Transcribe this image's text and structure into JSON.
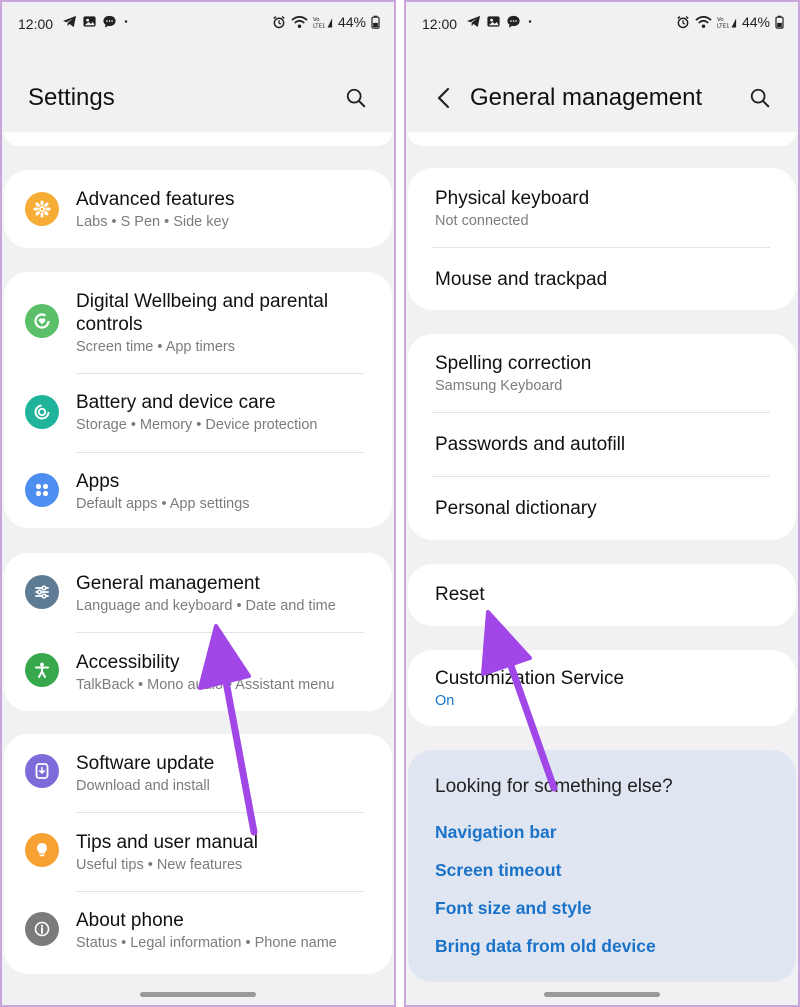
{
  "status_bar": {
    "time": "12:00",
    "battery": "44%",
    "network": "Vo)) LTE1"
  },
  "left_screen": {
    "title": "Settings",
    "items": [
      {
        "title": "Advanced features",
        "subtitle": "Labs  •  S Pen  •  Side key",
        "icon": "advanced-features-icon",
        "color": "#f6ac35"
      },
      {
        "title": "Digital Wellbeing and parental",
        "title_line2": "controls",
        "subtitle": "Screen time  •  App timers",
        "icon": "digital-wellbeing-icon",
        "color": "#5cc06a"
      },
      {
        "title": "Battery and device care",
        "subtitle": "Storage  •  Memory  •  Device protection",
        "icon": "device-care-icon",
        "color": "#1fb39c"
      },
      {
        "title": "Apps",
        "subtitle": "Default apps  •  App settings",
        "icon": "apps-icon",
        "color": "#4d8ff0"
      },
      {
        "title": "General management",
        "subtitle": "Language and keyboard  •  Date and time",
        "icon": "sliders-icon",
        "color": "#5e7b95"
      },
      {
        "title": "Accessibility",
        "subtitle": "TalkBack  •  Mono audio  •  Assistant menu",
        "icon": "accessibility-icon",
        "color": "#38a84d"
      },
      {
        "title": "Software update",
        "subtitle": "Download and install",
        "icon": "software-update-icon",
        "color": "#7c6bd8"
      },
      {
        "title": "Tips and user manual",
        "subtitle": "Useful tips  •  New features",
        "icon": "lightbulb-icon",
        "color": "#f6a132"
      },
      {
        "title": "About phone",
        "subtitle": "Status  •  Legal information  •  Phone name",
        "icon": "info-icon",
        "color": "#7b7b7b"
      }
    ]
  },
  "right_screen": {
    "title": "General management",
    "items": [
      {
        "title": "Physical keyboard",
        "subtitle": "Not connected"
      },
      {
        "title": "Mouse and trackpad"
      },
      {
        "title": "Spelling correction",
        "subtitle": "Samsung Keyboard"
      },
      {
        "title": "Passwords and autofill"
      },
      {
        "title": "Personal dictionary"
      },
      {
        "title": "Reset"
      },
      {
        "title": "Customization Service",
        "subtitle": "On"
      }
    ],
    "suggestions": {
      "heading": "Looking for something else?",
      "links": [
        "Navigation bar",
        "Screen timeout",
        "Font size and style",
        "Bring data from old device"
      ]
    }
  },
  "colors": {
    "accent_blue": "#1a73c8",
    "annotation_arrow": "#a147e8",
    "background": "#f1f1f3"
  }
}
